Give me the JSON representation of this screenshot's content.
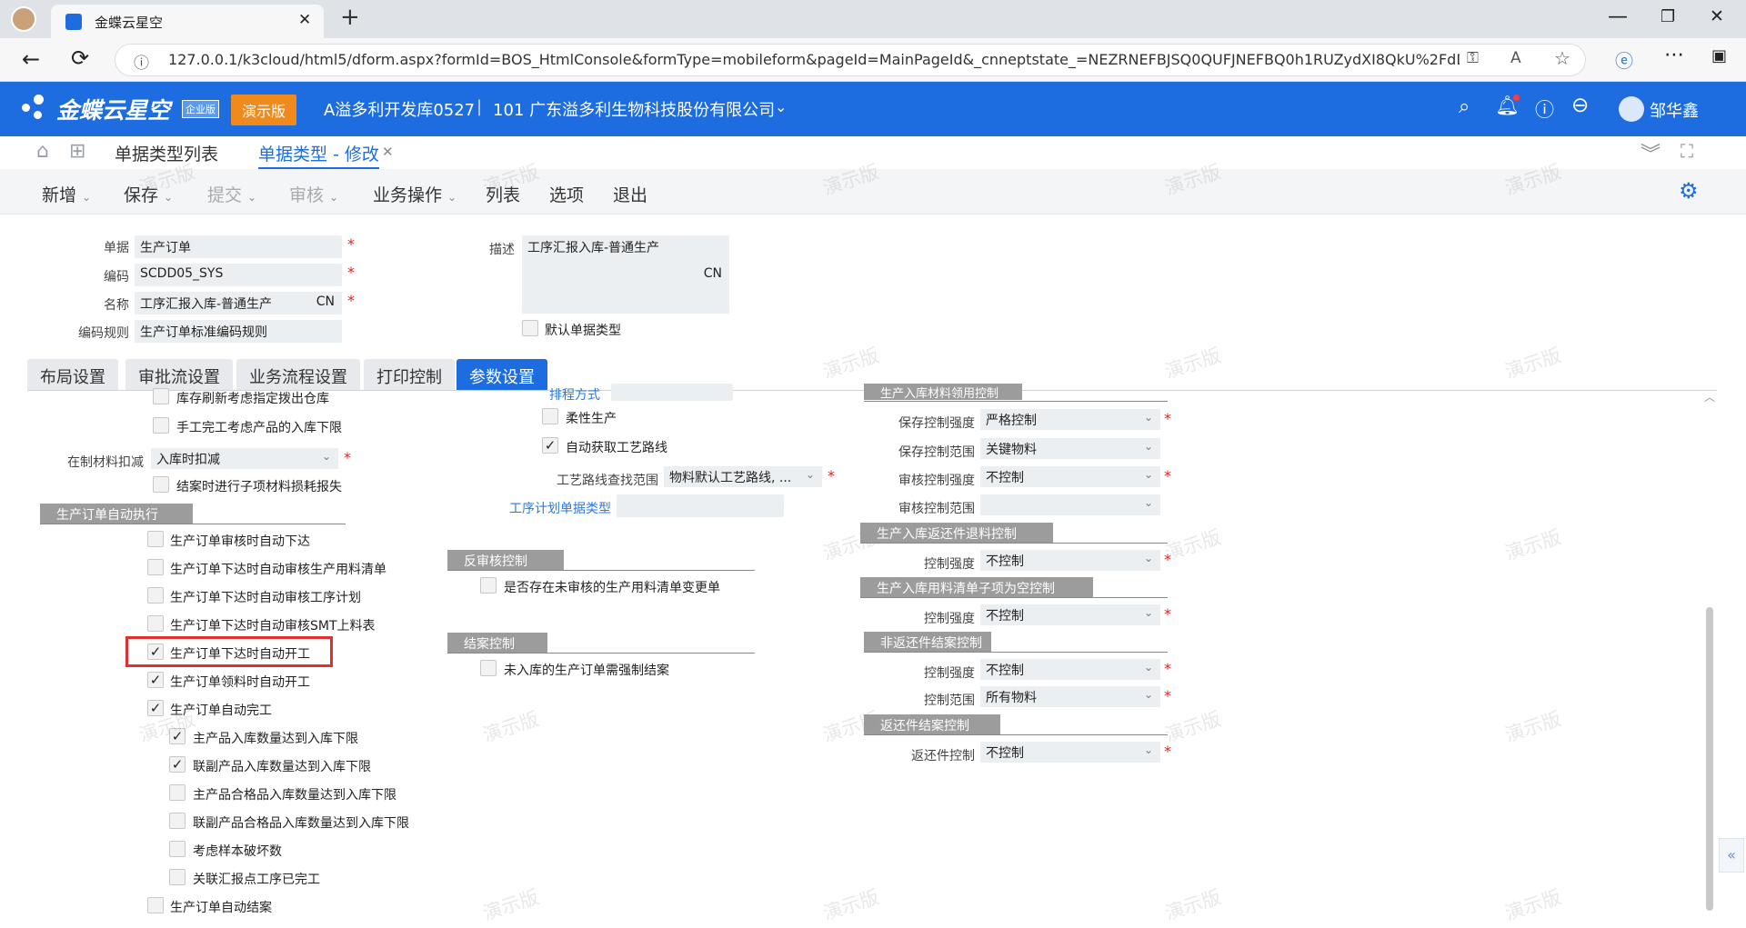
{
  "browser": {
    "tab_title": "金蝶云星空",
    "url": "127.0.0.1/k3cloud/html5/dform.aspx?formId=BOS_HtmlConsole&formType=mobileform&pageId=MainPageId&_cnneptstate_=NEZRNEFBJSQ0QUFJNEFBQ0h1RUZydXI8QkU%2FdD..."
  },
  "app": {
    "logo": "金蝶云星空",
    "edition": "企业版",
    "demo_badge": "演示版",
    "org": "A溢多利开发库0527",
    "company": "101 广东溢多利生物科技股份有限公司",
    "user": "邹华鑫"
  },
  "breadcrumb": {
    "list_tab": "单据类型列表",
    "edit_tab": "单据类型 - 修改"
  },
  "toolbar": {
    "new": "新增",
    "save": "保存",
    "submit": "提交",
    "audit": "审核",
    "biz": "业务操作",
    "list": "列表",
    "options": "选项",
    "exit": "退出"
  },
  "header_form": {
    "doc_label": "单据",
    "doc_value": "生产订单",
    "code_label": "编码",
    "code_value": "SCDD05_SYS",
    "name_label": "名称",
    "name_value": "工序汇报入库-普通生产",
    "name_lang": "CN",
    "rule_label": "编码规则",
    "rule_value": "生产订单标准编码规则",
    "desc_label": "描述",
    "desc_value": "工序汇报入库-普通生产",
    "desc_lang": "CN",
    "default_type": "默认单据类型"
  },
  "tabs": [
    "布局设置",
    "审批流设置",
    "业务流程设置",
    "打印控制",
    "参数设置"
  ],
  "col1": {
    "cb_refresh": "库存刷新考虑指定拨出仓库",
    "cb_manual": "手工完工考虑产品的入库下限",
    "wip_label": "在制材料扣减",
    "wip_value": "入库时扣减",
    "cb_close": "结案时进行子项材料损耗报失",
    "sec_auto": "生产订单自动执行",
    "items": [
      {
        "label": "生产订单审核时自动下达",
        "checked": false
      },
      {
        "label": "生产订单下达时自动审核生产用料清单",
        "checked": false
      },
      {
        "label": "生产订单下达时自动审核工序计划",
        "checked": false
      },
      {
        "label": "生产订单下达时自动审核SMT上料表",
        "checked": false
      },
      {
        "label": "生产订单下达时自动开工",
        "checked": true
      },
      {
        "label": "生产订单领料时自动开工",
        "checked": true
      },
      {
        "label": "生产订单自动完工",
        "checked": true
      }
    ],
    "subitems": [
      {
        "label": "主产品入库数量达到入库下限",
        "checked": true
      },
      {
        "label": "联副产品入库数量达到入库下限",
        "checked": true
      },
      {
        "label": "主产品合格品入库数量达到入库下限",
        "checked": false
      },
      {
        "label": "联副产品合格品入库数量达到入库下限",
        "checked": false
      },
      {
        "label": "考虑样本破坏数",
        "checked": false
      },
      {
        "label": "关联汇报点工序已完工",
        "checked": false
      }
    ],
    "cb_autoclose": "生产订单自动结案"
  },
  "col2": {
    "sched_label": "排程方式",
    "cb_flex": "柔性生产",
    "cb_route": "自动获取工艺路线",
    "route_range_label": "工艺路线查找范围",
    "route_range_value": "物料默认工艺路线, ...",
    "plan_type_label": "工序计划单据类型",
    "sec_unaudit": "反审核控制",
    "cb_unaudit": "是否存在未审核的生产用料清单变更单",
    "sec_close": "结案控制",
    "cb_forceclose": "未入库的生产订单需强制结案"
  },
  "col3": {
    "sec_material": "生产入库材料领用控制",
    "save_strength_label": "保存控制强度",
    "save_strength_value": "严格控制",
    "save_range_label": "保存控制范围",
    "save_range_value": "关键物料",
    "audit_strength_label": "审核控制强度",
    "audit_strength_value": "不控制",
    "audit_range_label": "审核控制范围",
    "sec_return": "生产入库返还件退料控制",
    "return_strength_label": "控制强度",
    "return_strength_value": "不控制",
    "sec_bom_null": "生产入库用料清单子项为空控制",
    "bom_strength_label": "控制强度",
    "bom_strength_value": "不控制",
    "sec_nonreturn": "非返还件结案控制",
    "nonreturn_strength_label": "控制强度",
    "nonreturn_strength_value": "不控制",
    "nonreturn_range_label": "控制范围",
    "nonreturn_range_value": "所有物料",
    "sec_returnclose": "返还件结案控制",
    "returnclose_label": "返还件控制",
    "returnclose_value": "不控制"
  },
  "watermark": "演示版",
  "colors": {
    "brand": "#1d6de0",
    "demo": "#f08a1c",
    "highlight": "#e03030"
  }
}
